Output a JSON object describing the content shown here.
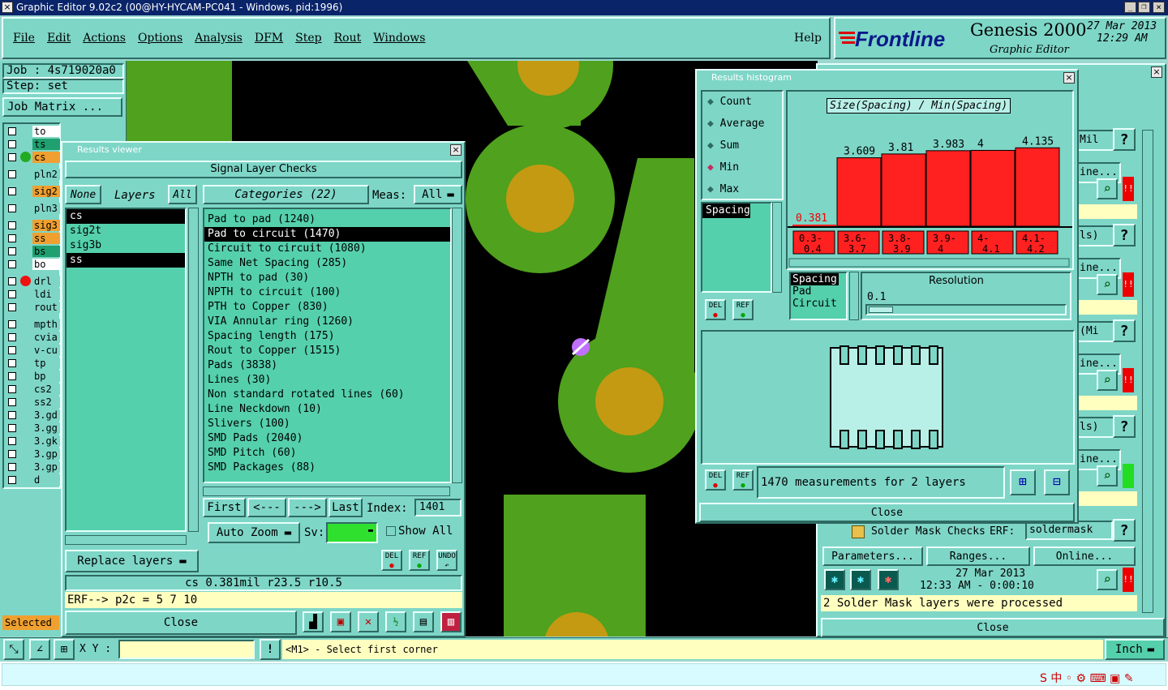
{
  "window_title": "Graphic Editor 9.02c2 (00@HY-HYCAM-PC041 - Windows, pid:1996)",
  "menu": [
    "File",
    "Edit",
    "Actions",
    "Options",
    "Analysis",
    "DFM",
    "Step",
    "Rout",
    "Windows"
  ],
  "help": "Help",
  "brand": {
    "logo": "Frontline",
    "product": "Genesis 2000",
    "subtitle": "Graphic Editor",
    "date": "27 Mar 2013",
    "time": "12:29 AM"
  },
  "job": {
    "job": "Job : 4s719020a0",
    "step": "Step: set",
    "matrix": "Job Matrix ..."
  },
  "layers": [
    {
      "name": "to",
      "color": "#ffffff"
    },
    {
      "name": "ts",
      "color": "#20a070"
    },
    {
      "name": "cs",
      "color": "#f0a030"
    },
    {
      "name": "pln2",
      "color": "#7ed6c7"
    },
    {
      "name": "sig2",
      "color": "#f0a030"
    },
    {
      "name": "pln3",
      "color": "#7ed6c7"
    },
    {
      "name": "sig3",
      "color": "#f0a030"
    },
    {
      "name": "ss",
      "color": "#f0a030"
    },
    {
      "name": "bs",
      "color": "#20a070"
    },
    {
      "name": "bo",
      "color": "#ffffff"
    },
    {
      "name": "drl",
      "color": "#7ed6c7"
    },
    {
      "name": "ldi",
      "color": "#7ed6c7"
    },
    {
      "name": "rout",
      "color": "#7ed6c7"
    },
    {
      "name": "mpth",
      "color": "#7ed6c7"
    },
    {
      "name": "cvia",
      "color": "#7ed6c7"
    },
    {
      "name": "v-cu",
      "color": "#7ed6c7"
    },
    {
      "name": "tp",
      "color": "#7ed6c7"
    },
    {
      "name": "bp",
      "color": "#7ed6c7"
    },
    {
      "name": "cs2",
      "color": "#7ed6c7"
    },
    {
      "name": "ss2",
      "color": "#7ed6c7"
    },
    {
      "name": "3.gd",
      "color": "#7ed6c7"
    },
    {
      "name": "3.gg",
      "color": "#7ed6c7"
    },
    {
      "name": "3.gk",
      "color": "#7ed6c7"
    },
    {
      "name": "3.gp",
      "color": "#7ed6c7"
    },
    {
      "name": "3.gp",
      "color": "#7ed6c7"
    },
    {
      "name": "d",
      "color": "#7ed6c7"
    }
  ],
  "selected_label": "Selected",
  "results_viewer": {
    "title": "Results viewer",
    "header": "Signal Layer Checks",
    "none": "None",
    "layers_label": "Layers",
    "all": "All",
    "layer_list": [
      "cs",
      "sig2t",
      "sig3b",
      "ss"
    ],
    "categories_label": "Categories (22)",
    "meas_label": "Meas:",
    "meas_value": "All",
    "categories": [
      "Pad to pad (1240)",
      "Pad to circuit (1470)",
      "Circuit to circuit (1080)",
      "Same Net Spacing (285)",
      "NPTH to pad (30)",
      "NPTH to circuit (100)",
      "PTH to Copper (830)",
      "VIA Annular ring (1260)",
      "Spacing length (175)",
      "Rout to Copper (1515)",
      "Pads (3838)",
      "Lines (30)",
      "Non standard rotated lines (60)",
      "Line Neckdown (10)",
      "Slivers (100)",
      "SMD Pads (2040)",
      "SMD Pitch (60)",
      "SMD Packages (88)"
    ],
    "nav": {
      "first": "First",
      "prev": "<---",
      "next": "--->",
      "last": "Last",
      "index_label": "Index:",
      "index_value": "1401"
    },
    "auto_zoom": "Auto Zoom",
    "sv": "Sv:",
    "show_all": "Show All",
    "replace": "Replace layers",
    "status": "cs 0.381mil r23.5 r10.5",
    "erf": "ERF--> p2c = 5 7 10",
    "close": "Close",
    "icons": {
      "del": "DEL",
      "ref": "REF",
      "undo": "UNDO"
    }
  },
  "histogram": {
    "title": "Results histogram",
    "modes": [
      "Count",
      "Average",
      "Sum",
      "Min",
      "Max"
    ],
    "mode_selected": "Min",
    "axis_title": "Size(Spacing) / Min(Spacing)",
    "left_list": [
      "Spacing"
    ],
    "res_list": [
      "Spacing",
      "Pad",
      "Circuit"
    ],
    "resolution_label": "Resolution",
    "resolution_value": "0.1",
    "measurements": "1470 measurements for 2 layers",
    "close": "Close"
  },
  "chart_data": {
    "type": "bar",
    "title": "Size(Spacing) / Min(Spacing)",
    "categories": [
      "0.3-0.4",
      "3.6-3.7",
      "3.8-3.9",
      "3.9-4",
      "4-4.1",
      "4.1-4.2"
    ],
    "values": [
      0.381,
      3.609,
      3.81,
      3.983,
      4,
      4.135
    ],
    "labels": [
      "0.381",
      "3.609",
      "3.81",
      "3.983",
      "4",
      "4.135"
    ],
    "color": "#ff2020"
  },
  "right_panel": {
    "labels": [
      "Mil",
      "ine...",
      "ls)",
      "ine...",
      "(Mi",
      "ine...",
      "ls)",
      "ine..."
    ],
    "solder": "Solder Mask Checks",
    "erf": "ERF:",
    "erf_value": "soldermask",
    "parameters": "Parameters...",
    "ranges": "Ranges...",
    "online": "Online...",
    "date": "27 Mar 2013",
    "time": "12:33 AM - 0:00:10",
    "processed": "2 Solder Mask layers were processed",
    "close": "Close"
  },
  "bottom": {
    "xy": "X Y :",
    "prompt": "<M1> - Select first corner",
    "unit": "Inch"
  }
}
